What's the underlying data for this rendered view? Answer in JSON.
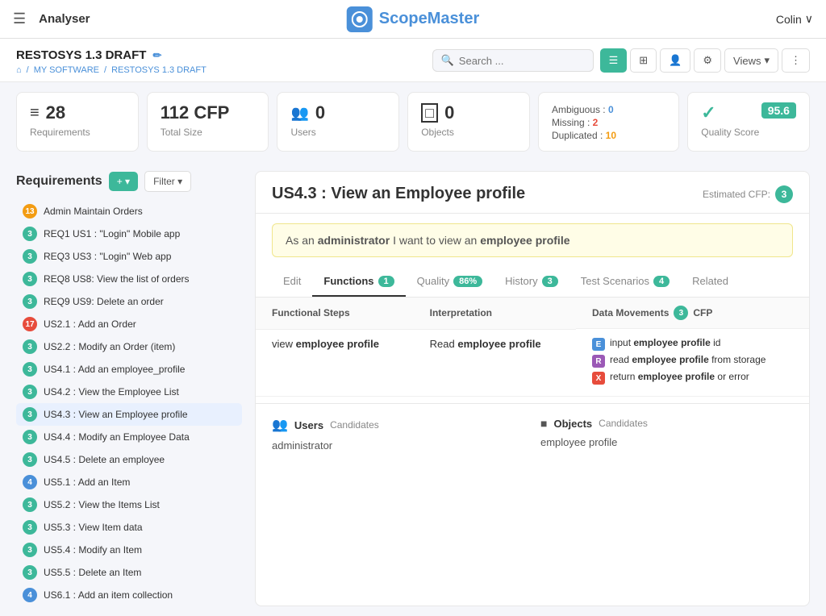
{
  "header": {
    "menu_label": "☰",
    "analyser_label": "Analyser",
    "logo_text": "Scope",
    "logo_text2": "Master",
    "user_label": "Colin",
    "user_chevron": "∨"
  },
  "breadcrumb": {
    "title": "RESTOSYS 1.3 DRAFT",
    "home_icon": "⌂",
    "my_software": "MY SOFTWARE",
    "current": "RESTOSYS 1.3 DRAFT",
    "sep": "/"
  },
  "search": {
    "placeholder": "Search ..."
  },
  "toolbar": {
    "list_icon": "☰",
    "grid_icon": "⊞",
    "person_icon": "👤",
    "settings_icon": "⚙",
    "views_label": "Views",
    "more_icon": "⋮"
  },
  "stats": {
    "requirements": {
      "value": "28",
      "label": "Requirements",
      "icon": "≡"
    },
    "cfp": {
      "value": "112 CFP",
      "label": "Total Size"
    },
    "users": {
      "value": "0",
      "label": "Users",
      "icon": "👥"
    },
    "objects": {
      "value": "0",
      "label": "Objects",
      "icon": "□"
    },
    "issues": {
      "ambiguous_label": "Ambiguous :",
      "ambiguous_value": "0",
      "missing_label": "Missing :",
      "missing_value": "2",
      "duplicated_label": "Duplicated :",
      "duplicated_value": "10"
    },
    "quality": {
      "label": "Quality Score",
      "value": "95.6",
      "icon": "✓"
    }
  },
  "requirements": {
    "title": "Requirements",
    "add_label": "+ ▾",
    "filter_label": "Filter ▾",
    "items": [
      {
        "badge": "13",
        "badge_type": "orange",
        "text": "Admin Maintain Orders"
      },
      {
        "badge": "3",
        "badge_type": "green",
        "text": "REQ1 US1 : \"Login\" Mobile app"
      },
      {
        "badge": "3",
        "badge_type": "green",
        "text": "REQ3 US3 : \"Login\" Web app"
      },
      {
        "badge": "3",
        "badge_type": "green",
        "text": "REQ8 US8: View the list of orders"
      },
      {
        "badge": "3",
        "badge_type": "green",
        "text": "REQ9 US9: Delete an order"
      },
      {
        "badge": "17",
        "badge_type": "red",
        "text": "US2.1 : Add an Order"
      },
      {
        "badge": "3",
        "badge_type": "green",
        "text": "US2.2 : Modify an Order (item)"
      },
      {
        "badge": "3",
        "badge_type": "green",
        "text": "US4.1 : Add an employee_profile"
      },
      {
        "badge": "3",
        "badge_type": "green",
        "text": "US4.2 : View the Employee List"
      },
      {
        "badge": "3",
        "badge_type": "green",
        "text": "US4.3 : View an Employee profile",
        "active": true
      },
      {
        "badge": "3",
        "badge_type": "green",
        "text": "US4.4 : Modify an Employee Data"
      },
      {
        "badge": "3",
        "badge_type": "green",
        "text": "US4.5 : Delete an employee"
      },
      {
        "badge": "4",
        "badge_type": "blue",
        "text": "US5.1 : Add an Item"
      },
      {
        "badge": "3",
        "badge_type": "green",
        "text": "US5.2 : View the Items List"
      },
      {
        "badge": "3",
        "badge_type": "green",
        "text": "US5.3 : View Item data"
      },
      {
        "badge": "3",
        "badge_type": "green",
        "text": "US5.4 : Modify an Item"
      },
      {
        "badge": "3",
        "badge_type": "green",
        "text": "US5.5 : Delete an Item"
      },
      {
        "badge": "4",
        "badge_type": "blue",
        "text": "US6.1 : Add an item collection"
      }
    ]
  },
  "content": {
    "title": "US4.3 : View an Employee profile",
    "estimated_cfp_label": "Estimated CFP:",
    "estimated_cfp_value": "3",
    "user_story": {
      "prefix": "As an",
      "actor": "administrator",
      "middle": "I want to view an",
      "subject": "employee profile"
    },
    "tabs": [
      {
        "id": "edit",
        "label": "Edit",
        "badge": null
      },
      {
        "id": "functions",
        "label": "Functions",
        "badge": "1",
        "active": true
      },
      {
        "id": "quality",
        "label": "Quality",
        "badge": "86%",
        "badge_type": "quality"
      },
      {
        "id": "history",
        "label": "History",
        "badge": "3"
      },
      {
        "id": "test-scenarios",
        "label": "Test Scenarios",
        "badge": "4"
      },
      {
        "id": "related",
        "label": "Related",
        "badge": null
      }
    ],
    "table": {
      "headers": {
        "steps": "Functional Steps",
        "interpretation": "Interpretation",
        "data_movements": "Data Movements",
        "cfp_badge": "3",
        "cfp_label": "CFP"
      },
      "rows": [
        {
          "step": "view employee profile",
          "step_bold": "employee profile",
          "interpretation": "Read employee profile",
          "interpretation_bold": "employee profile",
          "data_movements": [
            {
              "type": "E",
              "text_pre": "input ",
              "bold": "employee profile",
              "text_post": " id"
            },
            {
              "type": "R",
              "text_pre": "read ",
              "bold": "employee profile",
              "text_post": " from storage"
            },
            {
              "type": "X",
              "text_pre": "return ",
              "bold": "employee profile",
              "text_post": " or error"
            }
          ]
        }
      ]
    },
    "candidates": {
      "users": {
        "icon": "👥",
        "title": "Users",
        "sub": "Candidates",
        "value": "administrator"
      },
      "objects": {
        "icon": "■",
        "title": "Objects",
        "sub": "Candidates",
        "value": "employee profile"
      }
    }
  }
}
